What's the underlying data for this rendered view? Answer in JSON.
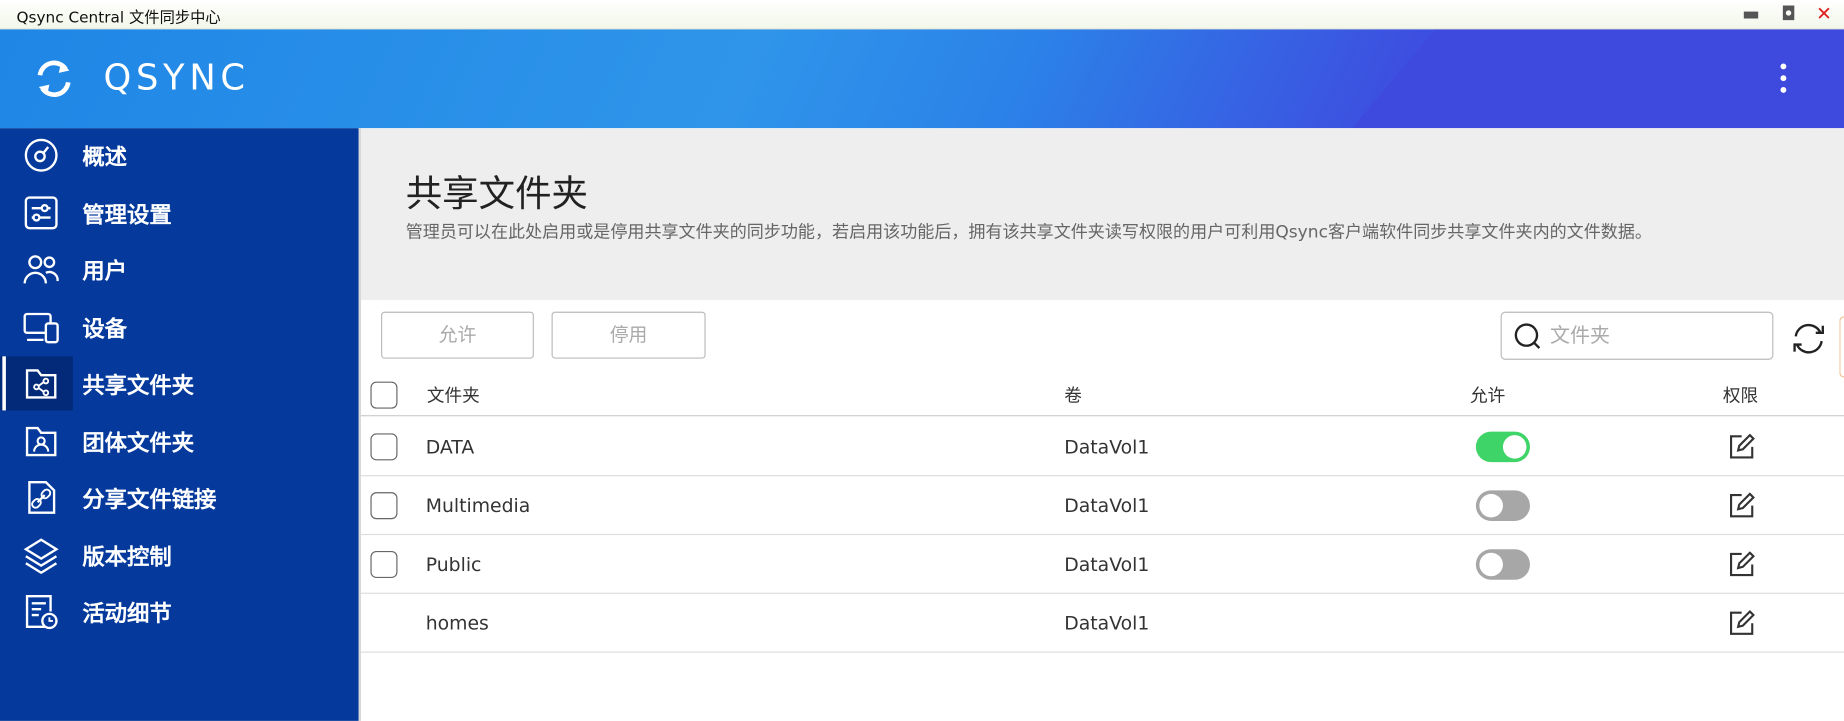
{
  "window": {
    "title": "Qsync Central 文件同步中心",
    "controls": [
      "minimize",
      "maximize",
      "close"
    ]
  },
  "header": {
    "brand": "QSYNC"
  },
  "sidebar": {
    "items": [
      {
        "label": "概述",
        "icon": "dashboard-icon"
      },
      {
        "label": "管理设置",
        "icon": "settings-sliders-icon"
      },
      {
        "label": "用户",
        "icon": "users-icon"
      },
      {
        "label": "设备",
        "icon": "devices-icon"
      },
      {
        "label": "共享文件夹",
        "icon": "shared-folder-icon",
        "active": true
      },
      {
        "label": "团体文件夹",
        "icon": "team-folder-icon"
      },
      {
        "label": "分享文件链接",
        "icon": "file-link-icon"
      },
      {
        "label": "版本控制",
        "icon": "layers-icon"
      },
      {
        "label": "活动细节",
        "icon": "activity-log-icon"
      }
    ]
  },
  "page": {
    "title": "共享文件夹",
    "description": "管理员可以在此处启用或是停用共享文件夹的同步功能，若启用该功能后，拥有该共享文件夹读写权限的用户可利用Qsync客户端软件同步共享文件夹内的文件数据。"
  },
  "toolbar": {
    "allow_label": "允许",
    "disable_label": "停用",
    "search_placeholder": "文件夹",
    "search_value": ""
  },
  "table": {
    "columns": {
      "folder": "文件夹",
      "volume": "卷",
      "allow": "允许",
      "permission": "权限"
    },
    "rows": [
      {
        "folder": "DATA",
        "volume": "DataVol1",
        "allowed": true,
        "checkbox": true,
        "toggle": true
      },
      {
        "folder": "Multimedia",
        "volume": "DataVol1",
        "allowed": false,
        "checkbox": true,
        "toggle": true
      },
      {
        "folder": "Public",
        "volume": "DataVol1",
        "allowed": false,
        "checkbox": true,
        "toggle": true
      },
      {
        "folder": "homes",
        "volume": "DataVol1",
        "allowed": false,
        "checkbox": false,
        "toggle": false
      }
    ]
  },
  "colors": {
    "sidebar": "#053a9c",
    "sidebar_active": "#022a79",
    "toggle_on": "#3fd467",
    "toggle_off": "#a7a7a7",
    "header_start": "#1f86e6",
    "header_end": "#3c44dc"
  }
}
